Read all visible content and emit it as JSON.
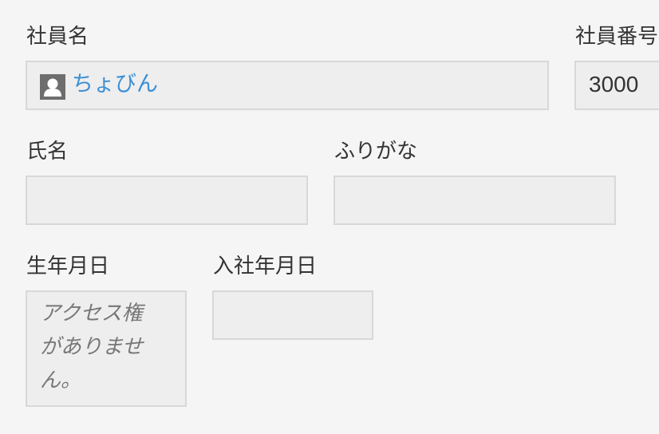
{
  "fields": {
    "employee_name": {
      "label": "社員名",
      "value": "ちょびん",
      "icon": "user-icon"
    },
    "employee_number": {
      "label": "社員番号",
      "value": "3000"
    },
    "full_name": {
      "label": "氏名",
      "value": ""
    },
    "furigana": {
      "label": "ふりがな",
      "value": ""
    },
    "birth_date": {
      "label": "生年月日",
      "message": "アクセス権がありません。"
    },
    "hire_date": {
      "label": "入社年月日",
      "value": ""
    }
  },
  "colors": {
    "background": "#f5f5f5",
    "field_background": "#eeeeee",
    "field_border": "#d8d8d8",
    "link": "#3a8fd5",
    "muted_text": "#777777"
  }
}
